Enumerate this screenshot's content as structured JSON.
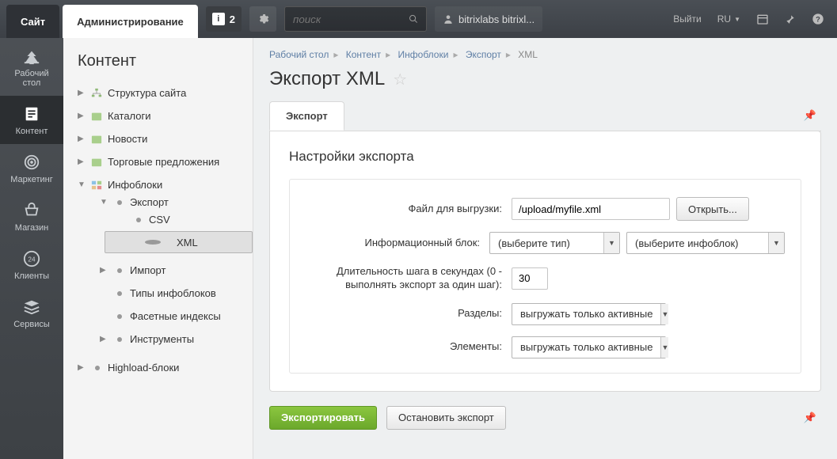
{
  "topbar": {
    "site_tab": "Сайт",
    "admin_tab": "Администрирование",
    "notif_count": "2",
    "search_placeholder": "поиск",
    "user_name": "bitrixlabs bitrixl...",
    "logout": "Выйти",
    "lang": "RU"
  },
  "rail": {
    "desktop": "Рабочий\nстол",
    "content": "Контент",
    "marketing": "Маркетинг",
    "shop": "Магазин",
    "clients": "Клиенты",
    "services": "Сервисы",
    "clients_badge": "24"
  },
  "sidebar": {
    "title": "Контент",
    "structure": "Структура сайта",
    "catalogs": "Каталоги",
    "news": "Новости",
    "trade": "Торговые предложения",
    "infoblocks": "Инфоблоки",
    "export": "Экспорт",
    "csv": "CSV",
    "xml": "XML",
    "import": "Импорт",
    "types": "Типы инфоблоков",
    "facet": "Фасетные индексы",
    "tools": "Инструменты",
    "highload": "Highload-блоки"
  },
  "crumbs": {
    "c1": "Рабочий стол",
    "c2": "Контент",
    "c3": "Инфоблоки",
    "c4": "Экспорт",
    "c5": "XML"
  },
  "page": {
    "title": "Экспорт XML",
    "tab": "Экспорт",
    "section_title": "Настройки экспорта"
  },
  "form": {
    "file_label": "Файл для выгрузки:",
    "file_value": "/upload/myfile.xml",
    "open_btn": "Открыть...",
    "iblock_label": "Информационный блок:",
    "type_placeholder": "(выберите тип)",
    "iblock_placeholder": "(выберите инфоблок)",
    "step_label": "Длительность шага в секундах (0 - выполнять экспорт за один шаг):",
    "step_value": "30",
    "sections_label": "Разделы:",
    "sections_value": "выгружать только активные",
    "elements_label": "Элементы:",
    "elements_value": "выгружать только активные",
    "export_btn": "Экспортировать",
    "stop_btn": "Остановить экспорт"
  }
}
